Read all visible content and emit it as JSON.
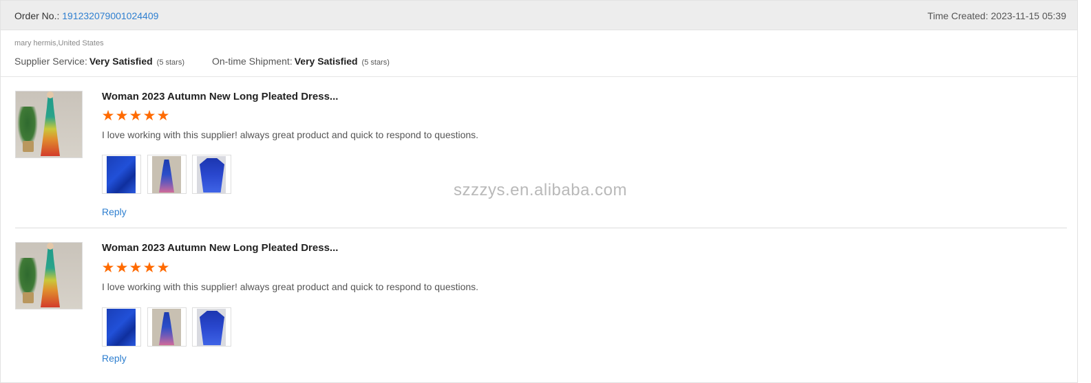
{
  "order": {
    "label": "Order No.:",
    "number": "191232079001024409",
    "time_label": "Time Created:",
    "time_value": "2023-11-15 05:39"
  },
  "buyer": {
    "name_country": "mary hermis,United States"
  },
  "ratings": {
    "supplier_service_label": "Supplier Service:",
    "supplier_service_value": "Very Satisfied",
    "supplier_service_stars": "(5 stars)",
    "shipment_label": "On-time Shipment:",
    "shipment_value": "Very Satisfied",
    "shipment_stars": "(5 stars)"
  },
  "reviews": [
    {
      "product_title": "Woman 2023 Autumn New Long Pleated Dress...",
      "rating": 5,
      "star_glyphs": [
        "★",
        "★",
        "★",
        "★",
        "★"
      ],
      "comment": "I love working with this supplier! always great product and quick to respond to questions.",
      "reply_label": "Reply"
    },
    {
      "product_title": "Woman 2023 Autumn New Long Pleated Dress...",
      "rating": 5,
      "star_glyphs": [
        "★",
        "★",
        "★",
        "★",
        "★"
      ],
      "comment": "I love working with this supplier! always great product and quick to respond to questions.",
      "reply_label": "Reply"
    }
  ],
  "watermark": "szzzys.en.alibaba.com",
  "colors": {
    "accent_link": "#2e7fd0",
    "star": "#ff6a00",
    "header_bg": "#ededed"
  }
}
